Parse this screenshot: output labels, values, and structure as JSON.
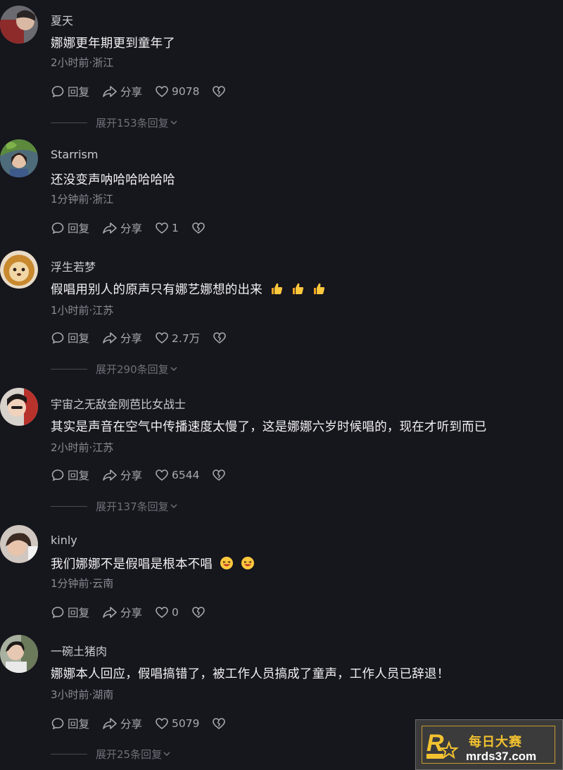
{
  "labels": {
    "reply": "回复",
    "share": "分享"
  },
  "comments": [
    {
      "username": "夏天",
      "text": "娜娜更年期更到童年了",
      "meta": "2小时前·浙江",
      "likes": "9078",
      "expand": "展开153条回复"
    },
    {
      "username": "Starrism",
      "text": "还没变声呐哈哈哈哈哈",
      "meta": "1分钟前·浙江",
      "likes": "1",
      "expand": ""
    },
    {
      "username": "浮生若梦",
      "text": "假唱用别人的原声只有娜艺娜想的出来",
      "meta": "1小时前·江苏",
      "likes": "2.7万",
      "expand": "展开290条回复",
      "emoji": "thumbs-up"
    },
    {
      "username": "宇宙之无敌金刚芭比女战士",
      "text": "其实是声音在空气中传播速度太慢了，这是娜娜六岁时候唱的，现在才听到而已",
      "meta": "2小时前·江苏",
      "likes": "6544",
      "expand": "展开137条回复"
    },
    {
      "username": "kinly",
      "text": "我们娜娜不是假唱是根本不唱",
      "meta": "1分钟前·云南",
      "likes": "0",
      "expand": "",
      "emoji": "laughing-face"
    },
    {
      "username": "一碗土猪肉",
      "text": "娜娜本人回应，假唱搞错了，被工作人员搞成了童声，工作人员已辞退！",
      "meta": "3小时前·湖南",
      "likes": "5079",
      "expand": "展开25条回复"
    }
  ],
  "watermark": {
    "title": "每日大赛",
    "url": "mrds37.com"
  },
  "colors": {
    "background": "#16161d",
    "text": "#f1f1f3",
    "meta": "#8b8b93",
    "watermark_gold": "#f2c230"
  }
}
